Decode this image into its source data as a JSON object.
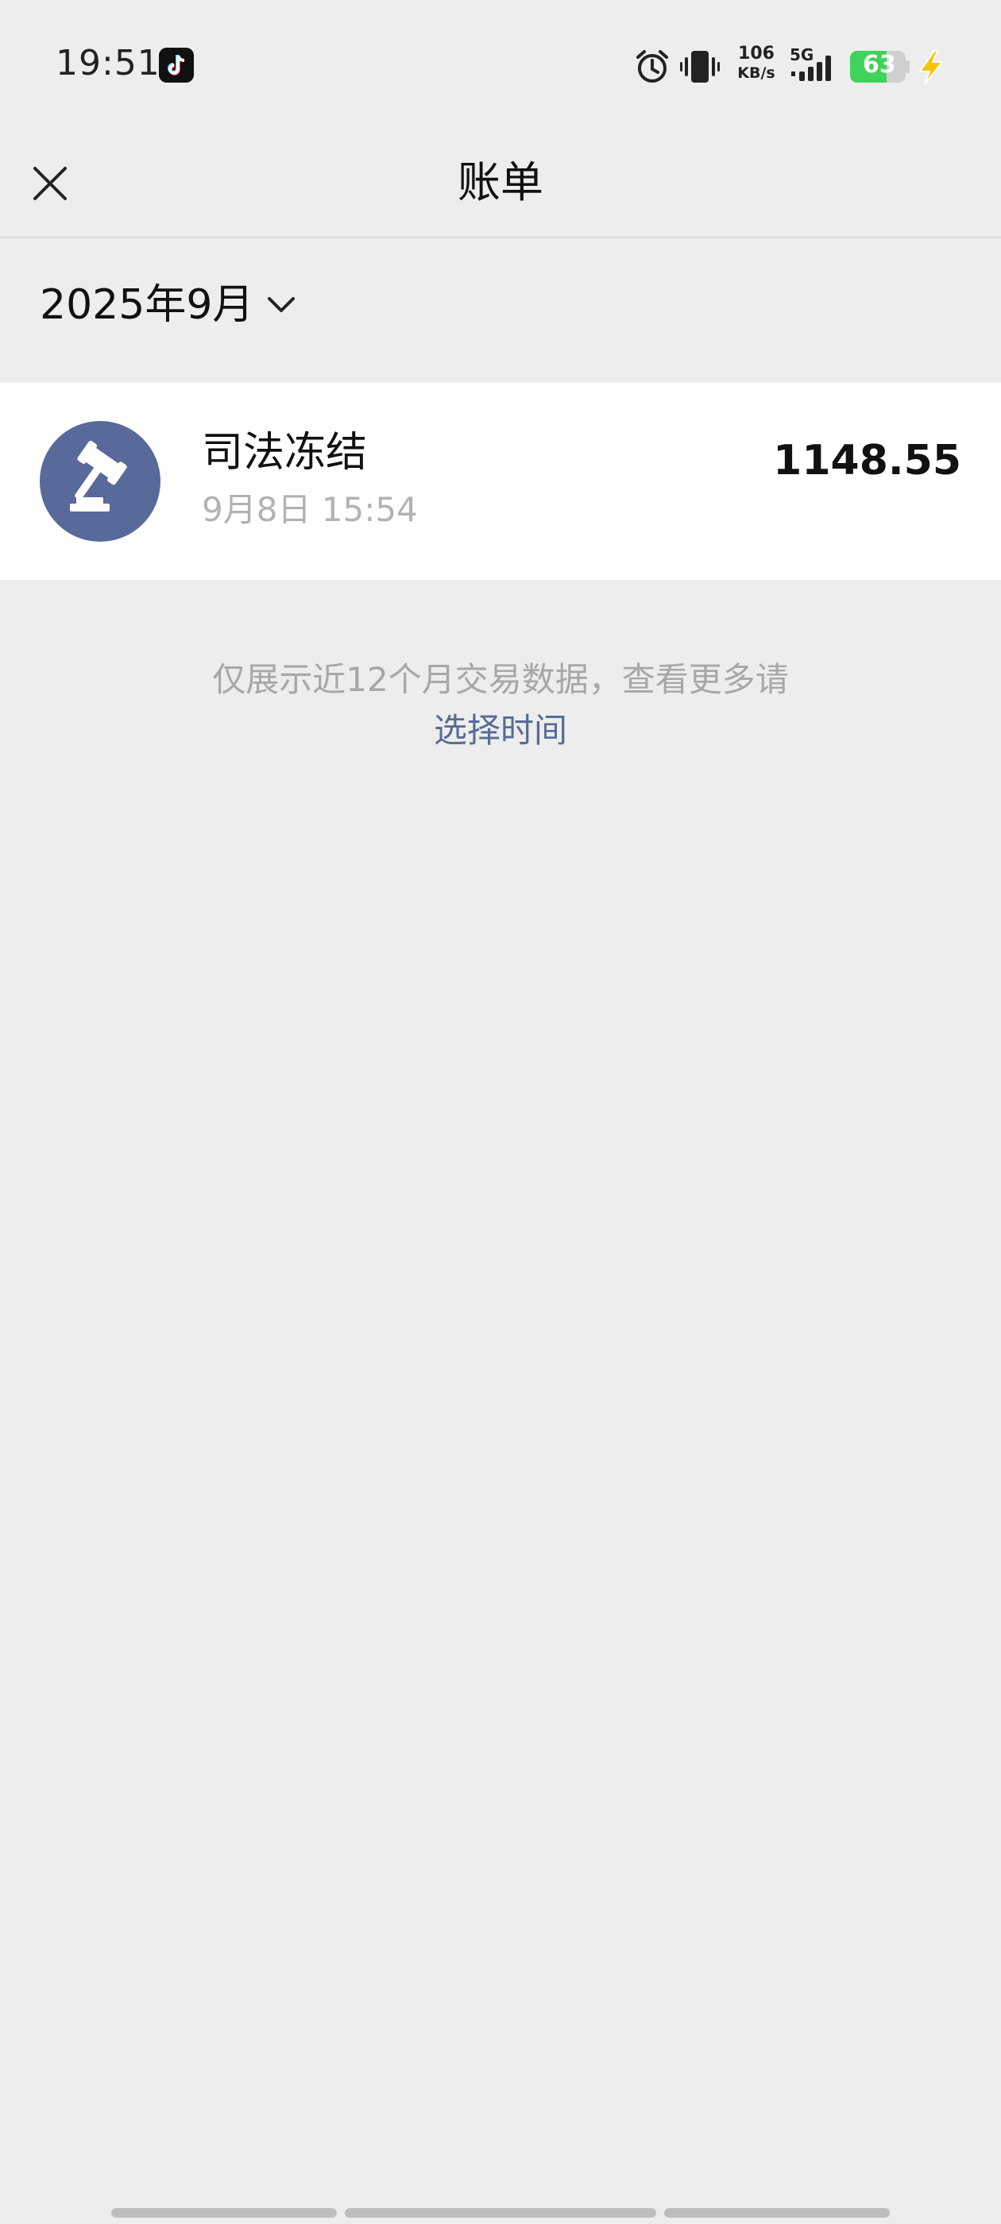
{
  "status_bar": {
    "time": "19:51",
    "app_icon": "tiktok-icon",
    "network_speed_value": "106",
    "network_speed_unit": "KB/s",
    "network_type": "5G",
    "battery_level": "63",
    "icons": [
      "alarm-icon",
      "vibrate-icon",
      "signal-icon",
      "battery-icon",
      "charge-icon"
    ]
  },
  "nav": {
    "title": "账单",
    "close_icon": "close-icon"
  },
  "month_selector": {
    "label": "2025年9月",
    "icon": "chevron-down-icon"
  },
  "transactions": [
    {
      "title": "司法冻结",
      "time": "9月8日 15:54",
      "amount": "1148.55",
      "icon": "gavel-icon"
    }
  ],
  "footer": {
    "note": "仅展示近12个月交易数据，查看更多请",
    "link": "选择时间"
  },
  "colors": {
    "background": "#ededed",
    "link": "#576b95",
    "avatar": "#58699a",
    "battery": "#3fd35a",
    "charge": "#f5c400"
  }
}
